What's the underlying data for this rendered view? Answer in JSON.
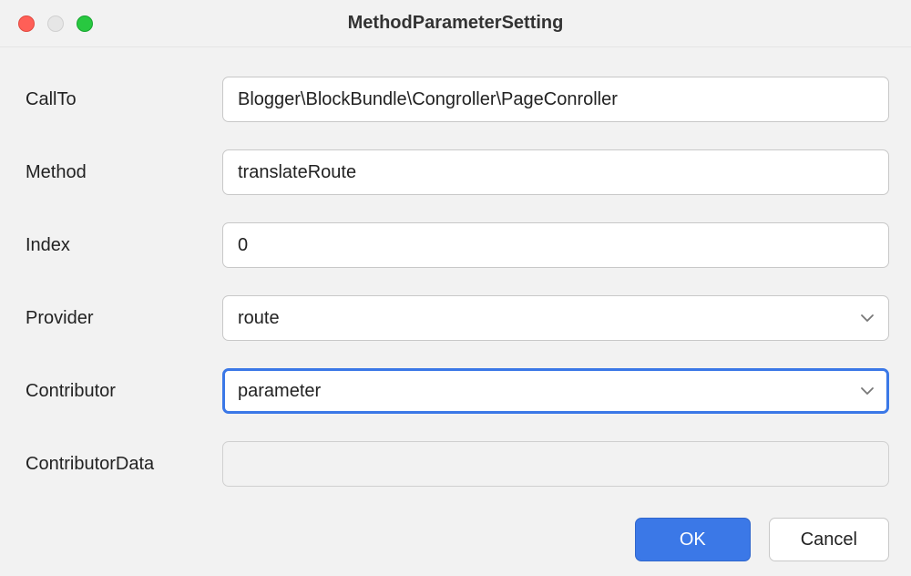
{
  "window": {
    "title": "MethodParameterSetting"
  },
  "form": {
    "callTo": {
      "label": "CallTo",
      "value": "Blogger\\BlockBundle\\Congroller\\PageConroller"
    },
    "method": {
      "label": "Method",
      "value": "translateRoute"
    },
    "index": {
      "label": "Index",
      "value": "0"
    },
    "provider": {
      "label": "Provider",
      "value": "route"
    },
    "contributor": {
      "label": "Contributor",
      "value": "parameter"
    },
    "contributorData": {
      "label": "ContributorData",
      "value": ""
    }
  },
  "buttons": {
    "ok": "OK",
    "cancel": "Cancel"
  }
}
